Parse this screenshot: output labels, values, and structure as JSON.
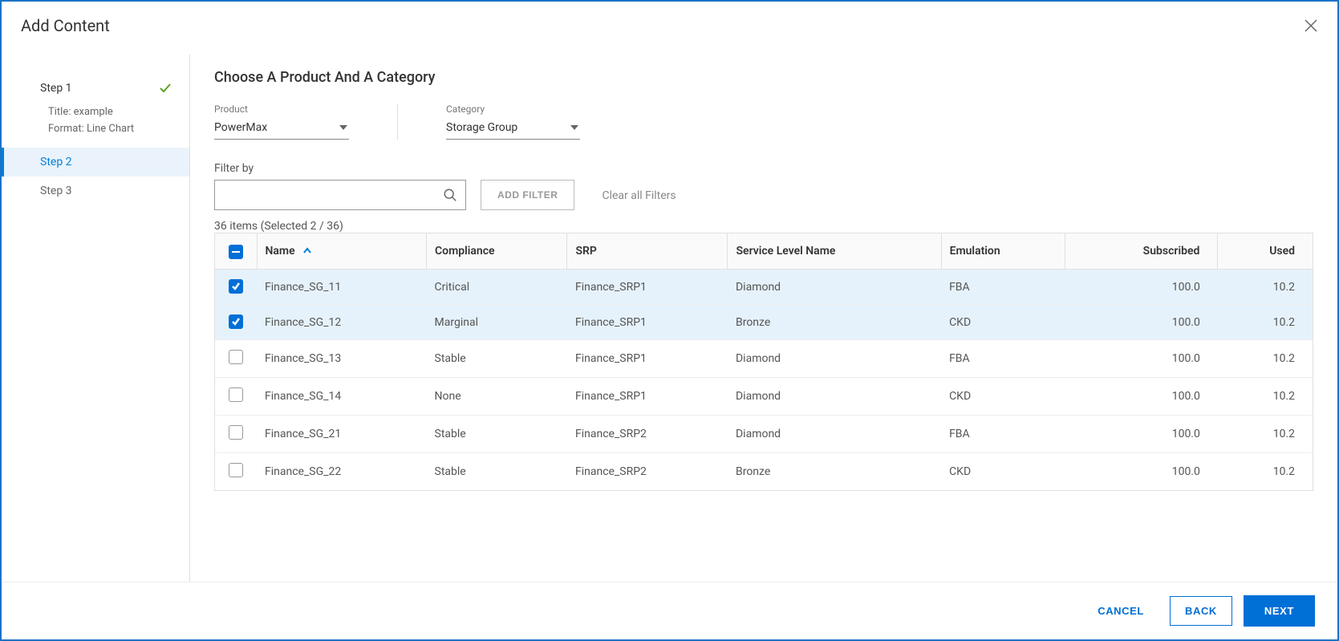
{
  "modal": {
    "title": "Add Content"
  },
  "stepper": {
    "steps": [
      {
        "label": "Step 1",
        "done": true,
        "subs": [
          "Title: example",
          "Format: Line Chart"
        ]
      },
      {
        "label": "Step 2",
        "active": true
      },
      {
        "label": "Step 3"
      }
    ]
  },
  "main": {
    "heading": "Choose A Product And A Category",
    "product": {
      "label": "Product",
      "value": "PowerMax"
    },
    "category": {
      "label": "Category",
      "value": "Storage Group"
    },
    "filter": {
      "label": "Filter by",
      "value": "",
      "placeholder": "",
      "add_filter_label": "ADD FILTER",
      "clear_label": "Clear all Filters"
    },
    "count_line": "36 items (Selected 2 / 36)"
  },
  "table": {
    "columns": [
      "Name",
      "Compliance",
      "SRP",
      "Service Level Name",
      "Emulation",
      "Subscribed",
      "Used"
    ],
    "sort_col_index": 0,
    "sort_dir": "asc",
    "rows": [
      {
        "sel": true,
        "name": "Finance_SG_11",
        "compliance": "Critical",
        "srp": "Finance_SRP1",
        "sln": "Diamond",
        "emu": "FBA",
        "sub": "100.0",
        "used": "10.2"
      },
      {
        "sel": true,
        "name": "Finance_SG_12",
        "compliance": "Marginal",
        "srp": "Finance_SRP1",
        "sln": "Bronze",
        "emu": "CKD",
        "sub": "100.0",
        "used": "10.2"
      },
      {
        "sel": false,
        "name": "Finance_SG_13",
        "compliance": "Stable",
        "srp": "Finance_SRP1",
        "sln": "Diamond",
        "emu": "FBA",
        "sub": "100.0",
        "used": "10.2"
      },
      {
        "sel": false,
        "name": "Finance_SG_14",
        "compliance": "None",
        "srp": "Finance_SRP1",
        "sln": "Diamond",
        "emu": "CKD",
        "sub": "100.0",
        "used": "10.2"
      },
      {
        "sel": false,
        "name": "Finance_SG_21",
        "compliance": "Stable",
        "srp": "Finance_SRP2",
        "sln": "Diamond",
        "emu": "FBA",
        "sub": "100.0",
        "used": "10.2"
      },
      {
        "sel": false,
        "name": "Finance_SG_22",
        "compliance": "Stable",
        "srp": "Finance_SRP2",
        "sln": "Bronze",
        "emu": "CKD",
        "sub": "100.0",
        "used": "10.2"
      }
    ]
  },
  "footer": {
    "cancel": "CANCEL",
    "back": "BACK",
    "next": "NEXT"
  }
}
